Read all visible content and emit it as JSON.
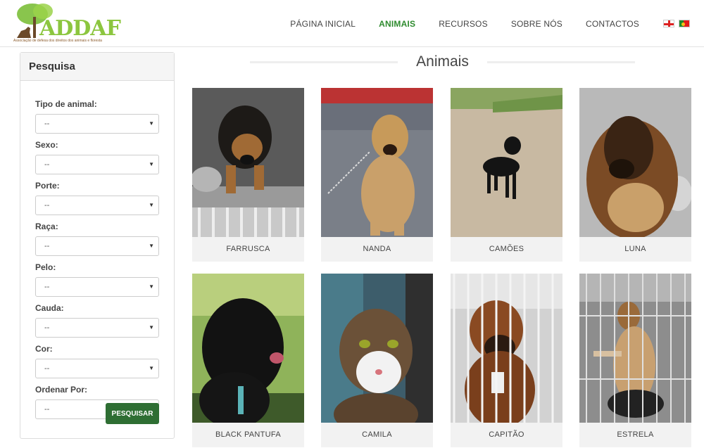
{
  "logo": {
    "text": "ADDAF",
    "tagline": "Associação de defesa dos direitos dos animais e floresta"
  },
  "nav": {
    "items": [
      {
        "label": "PÁGINA INICIAL",
        "active": false
      },
      {
        "label": "ANIMAIS",
        "active": true
      },
      {
        "label": "RECURSOS",
        "active": false
      },
      {
        "label": "SOBRE NÓS",
        "active": false
      },
      {
        "label": "CONTACTOS",
        "active": false
      }
    ],
    "flags": [
      "english-flag-icon",
      "portuguese-flag-icon"
    ]
  },
  "sidebar": {
    "title": "Pesquisa",
    "fields": [
      {
        "label": "Tipo de animal:",
        "value": "--"
      },
      {
        "label": "Sexo:",
        "value": "--"
      },
      {
        "label": "Porte:",
        "value": "--"
      },
      {
        "label": "Raça:",
        "value": "--"
      },
      {
        "label": "Pelo:",
        "value": "--"
      },
      {
        "label": "Cauda:",
        "value": "--"
      },
      {
        "label": "Cor:",
        "value": "--"
      },
      {
        "label": "Ordenar Por:",
        "value": "--"
      }
    ],
    "search_label": "PESQUISAR"
  },
  "main": {
    "title": "Animais",
    "animals": [
      {
        "name": "FARRUSCA"
      },
      {
        "name": "NANDA"
      },
      {
        "name": "CAMÕES"
      },
      {
        "name": "LUNA"
      },
      {
        "name": "BLACK PANTUFA"
      },
      {
        "name": "CAMILA"
      },
      {
        "name": "CAPITÃO"
      },
      {
        "name": "ESTRELA"
      }
    ]
  },
  "colors": {
    "accent": "#2e8b2e",
    "button": "#2e6e33"
  }
}
